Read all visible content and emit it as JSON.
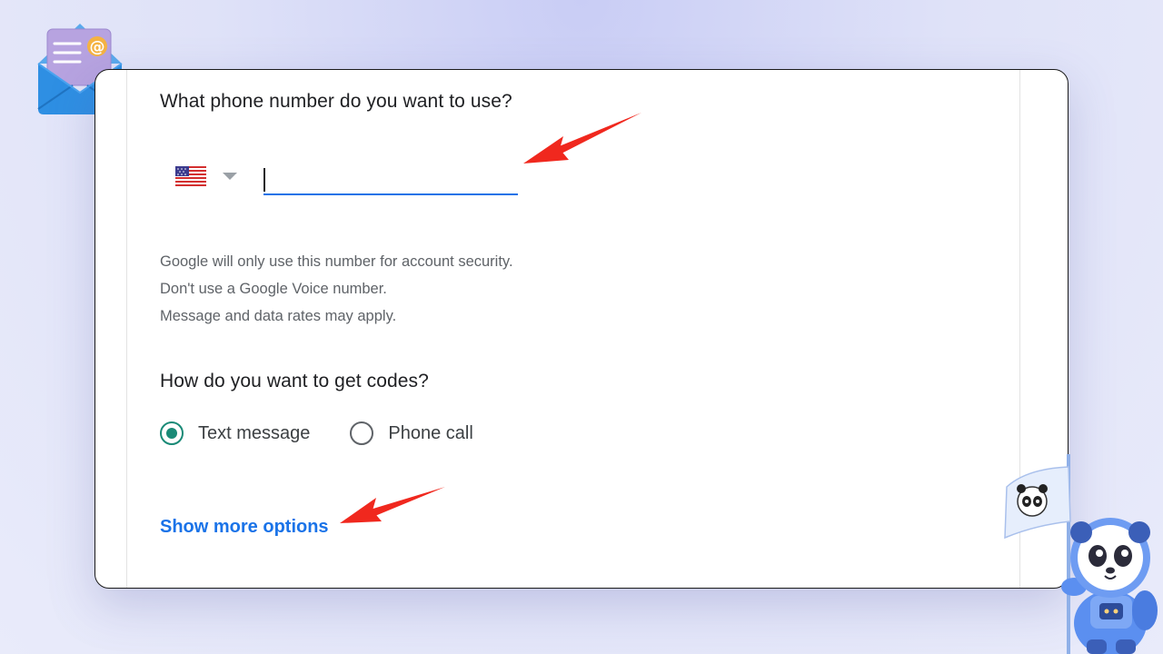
{
  "form": {
    "phone_question": "What phone number do you want to use?",
    "country_flag": "us-flag-icon",
    "phone_value": "",
    "help_lines": [
      "Google will only use this number for account security.",
      "Don't use a Google Voice number.",
      "Message and data rates may apply."
    ],
    "codes_question": "How do you want to get codes?",
    "options": [
      {
        "label": "Text message",
        "selected": true
      },
      {
        "label": "Phone call",
        "selected": false
      }
    ],
    "more_options_link": "Show more options"
  },
  "colors": {
    "accent_blue": "#1a73e8",
    "radio_selected": "#1a8a77",
    "annotation_arrow": "#f0281e",
    "background": "#dfe2f8"
  },
  "decorations": {
    "top_left": "email-envelope-icon",
    "bottom_right": "panda-astronaut-mascot"
  }
}
